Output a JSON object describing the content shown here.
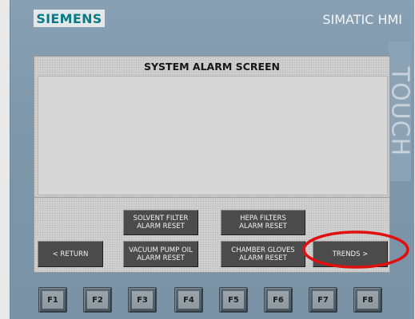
{
  "panel": {
    "logo": "SIEMENS",
    "brand": "SIMATIC HMI",
    "side_label": "TOUCH"
  },
  "screen": {
    "title": "SYSTEM ALARM SCREEN"
  },
  "buttons": {
    "solvent_filter": "SOLVENT FILTER\nALARM RESET",
    "hepa_filters": "HEPA FILTERS\nALARM RESET",
    "return": "< RETURN",
    "vacuum_pump_oil": "VACUUM PUMP OIL\nALARM RESET",
    "chamber_gloves": "CHAMBER GLOVES\nALARM RESET",
    "trends": "TRENDS >"
  },
  "function_keys": [
    "F1",
    "F2",
    "F3",
    "F4",
    "F5",
    "F6",
    "F7",
    "F8"
  ],
  "colors": {
    "highlight": "#e01010"
  }
}
